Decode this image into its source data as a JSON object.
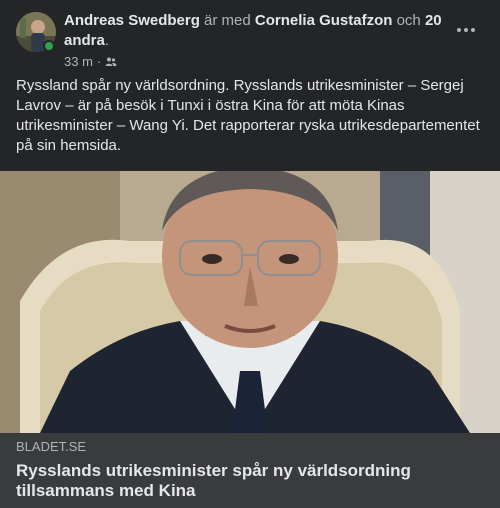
{
  "post": {
    "author": {
      "name": "Andreas Swedberg",
      "with_text": "är med",
      "tagged": "Cornelia Gustafzon",
      "and_text": "och",
      "others": "20 andra",
      "period": "."
    },
    "meta": {
      "time": "33 m",
      "separator": "·",
      "audience_icon": "friends-icon"
    },
    "more_icon": "more-horizontal-icon",
    "text": "Ryssland spår ny världsordning. Rysslands utrikesminister – Sergej Lavrov – är på besök i Tunxi i östra Kina för att möta Kinas utrikesminister – Wang Yi. Det rapporterar ryska utrikesdepartementet på sin hemsida.",
    "image_icon": "news-photo-man-in-suit",
    "link": {
      "domain": "BLADET.SE",
      "title": "Rysslands utrikesminister spår ny världsordning tillsammans med Kina"
    }
  },
  "colors": {
    "background": "#242526",
    "preview_background": "#3a3b3c",
    "text_primary": "#e4e6eb",
    "text_secondary": "#b0b3b8",
    "online": "#31a24c"
  }
}
